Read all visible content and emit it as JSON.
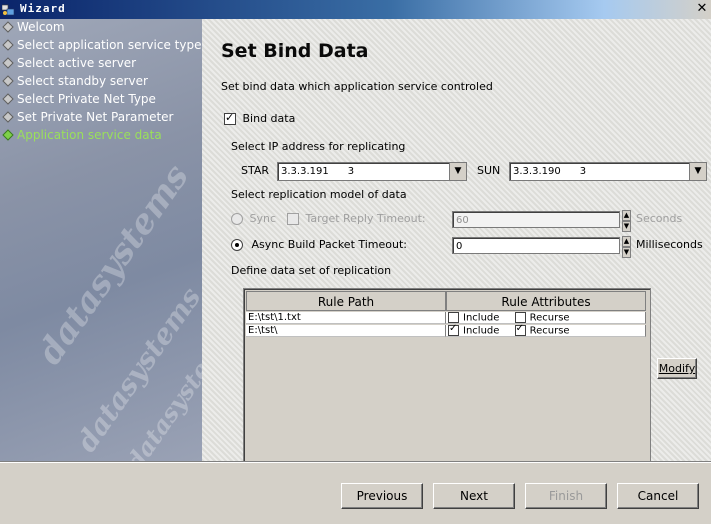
{
  "window": {
    "title": "Wizard"
  },
  "steps": [
    {
      "label": "Welcom",
      "state": "done"
    },
    {
      "label": "Select application service type",
      "state": "done"
    },
    {
      "label": "Select active server",
      "state": "done"
    },
    {
      "label": "Select standby server",
      "state": "done"
    },
    {
      "label": "Select Private Net Type",
      "state": "done"
    },
    {
      "label": "Set Private Net Parameter",
      "state": "done"
    },
    {
      "label": "Application service data",
      "state": "active"
    }
  ],
  "watermark": [
    "datasystems",
    "datasystems",
    "datasystems"
  ],
  "page": {
    "title": "Set Bind Data",
    "description": "Set bind data which application service controled"
  },
  "bind": {
    "label": "Bind data",
    "checked": true
  },
  "ip": {
    "section_label": "Select IP address for replicating",
    "star_label": "STAR",
    "star_value": "3.3.3.191      3",
    "sun_label": "SUN",
    "sun_value": "3.3.3.190      3"
  },
  "replication": {
    "section_label": "Select replication model of data",
    "sync_label": "Sync",
    "target_reply_label": "Target Reply Timeout:",
    "target_reply_value": "60",
    "seconds_label": "Seconds",
    "async_label": "Async Build Packet Timeout:",
    "async_value": "0",
    "milliseconds_label": "Milliseconds",
    "mode": "async"
  },
  "dataset": {
    "section_label": "Define data set of replication",
    "columns": [
      "Rule Path",
      "Rule Attributes"
    ],
    "include_label": "Include",
    "recurse_label": "Recurse",
    "rows": [
      {
        "path": "E:\\tst\\1.txt",
        "include": false,
        "recurse": false
      },
      {
        "path": "E:\\tst\\",
        "include": true,
        "recurse": true
      }
    ],
    "modify_label": "Modify"
  },
  "buttons": {
    "previous": "Previous",
    "next": "Next",
    "finish": "Finish",
    "cancel": "Cancel"
  },
  "colors": {
    "title_bar": "#0a246a",
    "active_step": "#9ae05a",
    "dialog": "#d4d0c8"
  }
}
